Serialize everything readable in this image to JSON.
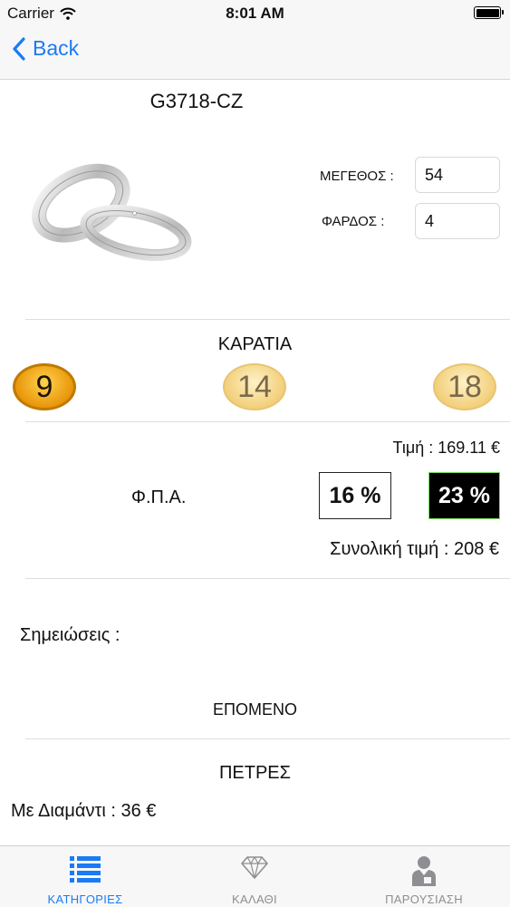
{
  "status": {
    "carrier": "Carrier",
    "time": "8:01 AM"
  },
  "nav": {
    "back_label": "Back"
  },
  "product": {
    "code": "G3718-CZ"
  },
  "form": {
    "size_label": "ΜΕΓΕΘΟΣ :",
    "size_value": "54",
    "width_label": "ΦΑΡΔΟΣ :",
    "width_value": "4"
  },
  "karats": {
    "title": "ΚΑΡΑΤΙΑ",
    "options": [
      "9",
      "14",
      "18"
    ],
    "selected": "9"
  },
  "price": {
    "label": "Τιμή : 169.11 €",
    "vat_label": "Φ.Π.Α.",
    "vat_options": [
      "16 %",
      "23 %"
    ],
    "vat_selected": "23 %",
    "total_label": "Συνολική τιμή : 208 €"
  },
  "notes": {
    "label": "Σημειώσεις :"
  },
  "next": {
    "label": "ΕΠΟΜΕΝΟ"
  },
  "stones": {
    "title": "ΠΕΤΡΕΣ",
    "diamond_label": "Με Διαμάντι : 36 €"
  },
  "tabs": [
    {
      "label": "ΚΑΤΗΓΟΡΙΕΣ",
      "icon": "list-icon",
      "active": true
    },
    {
      "label": "ΚΑΛΑΘΙ",
      "icon": "diamond-icon",
      "active": false
    },
    {
      "label": "ΠΑΡΟΥΣΙΑΣΗ",
      "icon": "presenter-icon",
      "active": false
    }
  ],
  "colors": {
    "accent": "#1a7bf5",
    "tab_inactive": "#8e8e93",
    "selected_vat_border": "#76e05a"
  }
}
